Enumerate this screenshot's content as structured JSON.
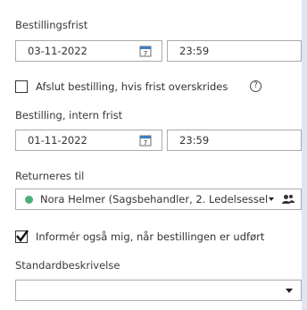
{
  "form": {
    "deadline": {
      "label": "Bestillingsfrist",
      "date": "03-11-2022",
      "time": "23:59",
      "calendar_icon": "calendar-icon"
    },
    "close_if_exceeded": {
      "label": "Afslut bestilling, hvis frist overskrides",
      "checked": false,
      "help_icon": "question-circle-icon",
      "help_glyph": "?"
    },
    "internal_deadline": {
      "label": "Bestilling, intern frist",
      "date": "01-11-2022",
      "time": "23:59",
      "calendar_icon": "calendar-icon"
    },
    "return_to": {
      "label": "Returneres til",
      "selected": "Nora Helmer (Sagsbehandler, 2. Ledelsessel",
      "status_color": "#4caf7e",
      "dropdown_icon": "caret-down-icon",
      "people_icon": "people-icon"
    },
    "notify_me": {
      "label": "Informér også mig, når bestillingen er udført",
      "checked": true
    },
    "standard_description": {
      "label": "Standardbeskrivelse",
      "selected": "",
      "dropdown_icon": "caret-down-icon"
    }
  },
  "colors": {
    "background": "#dde6f1",
    "panel": "#ffffff",
    "border": "#ababab"
  }
}
